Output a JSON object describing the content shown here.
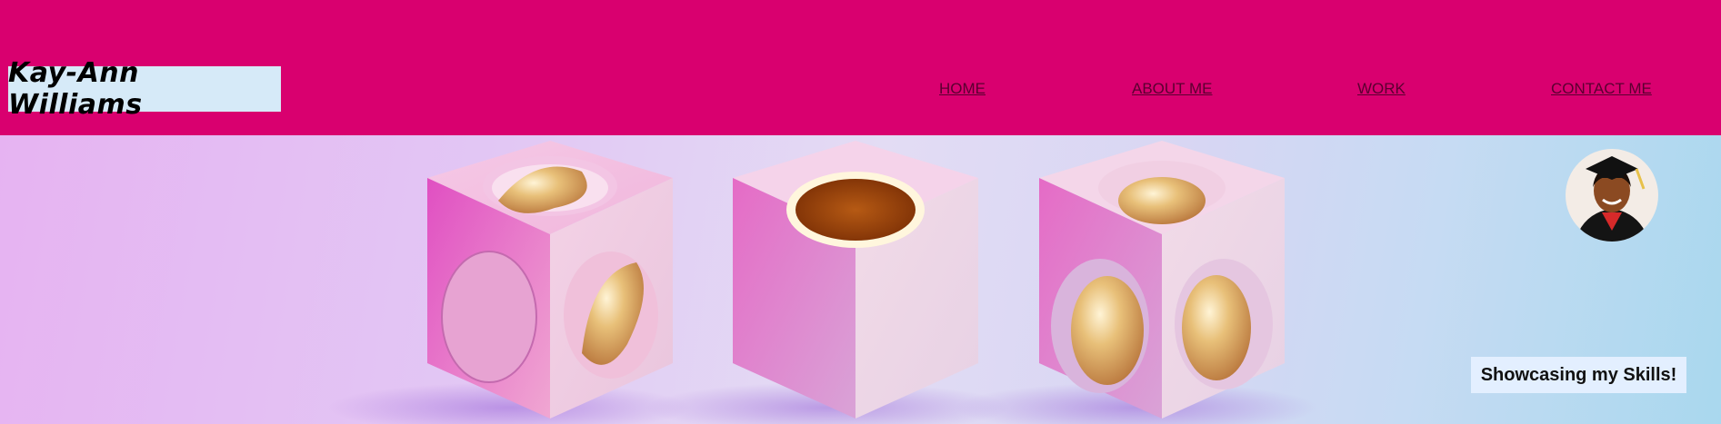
{
  "site": {
    "brand_name": "Kay-Ann Williams"
  },
  "nav": {
    "items": [
      {
        "label": "HOME"
      },
      {
        "label": "ABOUT ME"
      },
      {
        "label": "WORK"
      },
      {
        "label": "CONTACT ME"
      }
    ]
  },
  "hero": {
    "tagline": "Showcasing my Skills!",
    "image_subject": "three pink cubes with circular cutouts containing gold spheres",
    "avatar_subject": "graduate portrait in cap and gown"
  },
  "colors": {
    "header_bg": "#d9006f",
    "brand_bg": "#d6eaf8",
    "tagline_bg": "#e3efff",
    "nav_text": "#5a0030"
  }
}
